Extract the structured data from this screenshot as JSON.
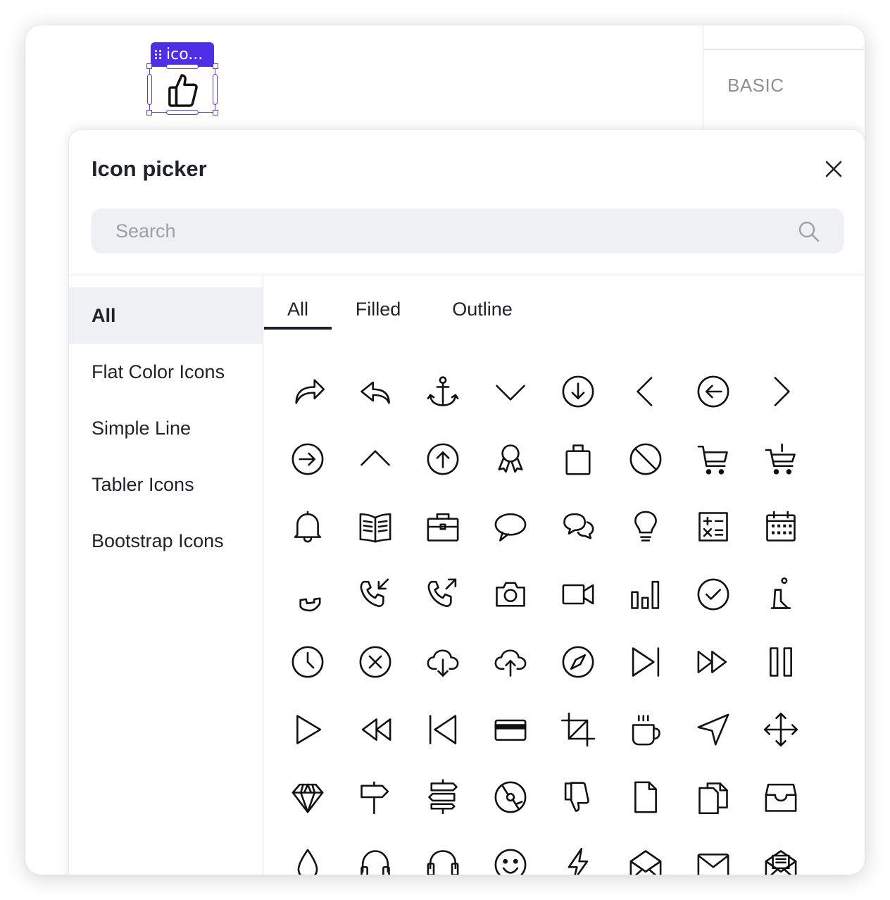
{
  "widget": {
    "tag_label": "ico...",
    "icon": "thumbs-up-icon",
    "accent": "#4f2ee8"
  },
  "right_panel": {
    "section_label": "BASIC"
  },
  "dialog": {
    "title": "Icon picker",
    "close_icon": "close-icon",
    "search": {
      "placeholder": "Search",
      "value": ""
    },
    "sidebar": [
      {
        "label": "All",
        "active": true
      },
      {
        "label": "Flat Color Icons",
        "active": false
      },
      {
        "label": "Simple Line",
        "active": false
      },
      {
        "label": "Tabler Icons",
        "active": false
      },
      {
        "label": "Bootstrap Icons",
        "active": false
      }
    ],
    "tabs": [
      {
        "label": "All",
        "active": true
      },
      {
        "label": "Filled",
        "active": false
      },
      {
        "label": "Outline",
        "active": false
      }
    ],
    "icons": [
      "share-arrow-icon",
      "reply-icon",
      "anchor-icon",
      "chevron-down-icon",
      "arrow-down-circle-icon",
      "chevron-left-icon",
      "arrow-left-circle-icon",
      "chevron-right-icon",
      "arrow-right-circle-icon",
      "chevron-up-icon",
      "arrow-up-circle-icon",
      "award-icon",
      "shopping-bag-icon",
      "ban-icon",
      "cart-icon",
      "cart-plus-icon",
      "bell-icon",
      "book-open-icon",
      "briefcase-icon",
      "chat-bubble-icon",
      "chat-bubbles-icon",
      "lightbulb-icon",
      "calculator-icon",
      "calendar-icon",
      "phone-icon",
      "phone-incoming-icon",
      "phone-outgoing-icon",
      "camera-icon",
      "video-camera-icon",
      "bar-chart-icon",
      "check-circle-icon",
      "chemistry-icon",
      "clock-icon",
      "x-circle-icon",
      "cloud-download-icon",
      "cloud-upload-icon",
      "compass-icon",
      "skip-forward-icon",
      "fast-forward-icon",
      "pause-icon",
      "play-icon",
      "rewind-icon",
      "skip-back-icon",
      "credit-card-icon",
      "crop-icon",
      "coffee-cup-icon",
      "navigation-icon",
      "move-icon",
      "diamond-icon",
      "signpost-icon",
      "signposts-icon",
      "disc-icon",
      "thumbs-down-icon",
      "file-icon",
      "files-icon",
      "inbox-icon",
      "droplet-icon",
      "headphones-icon",
      "headset-icon",
      "smile-icon",
      "lightning-icon",
      "envelope-open-icon",
      "envelope-icon",
      "envelope-letter-icon"
    ]
  }
}
